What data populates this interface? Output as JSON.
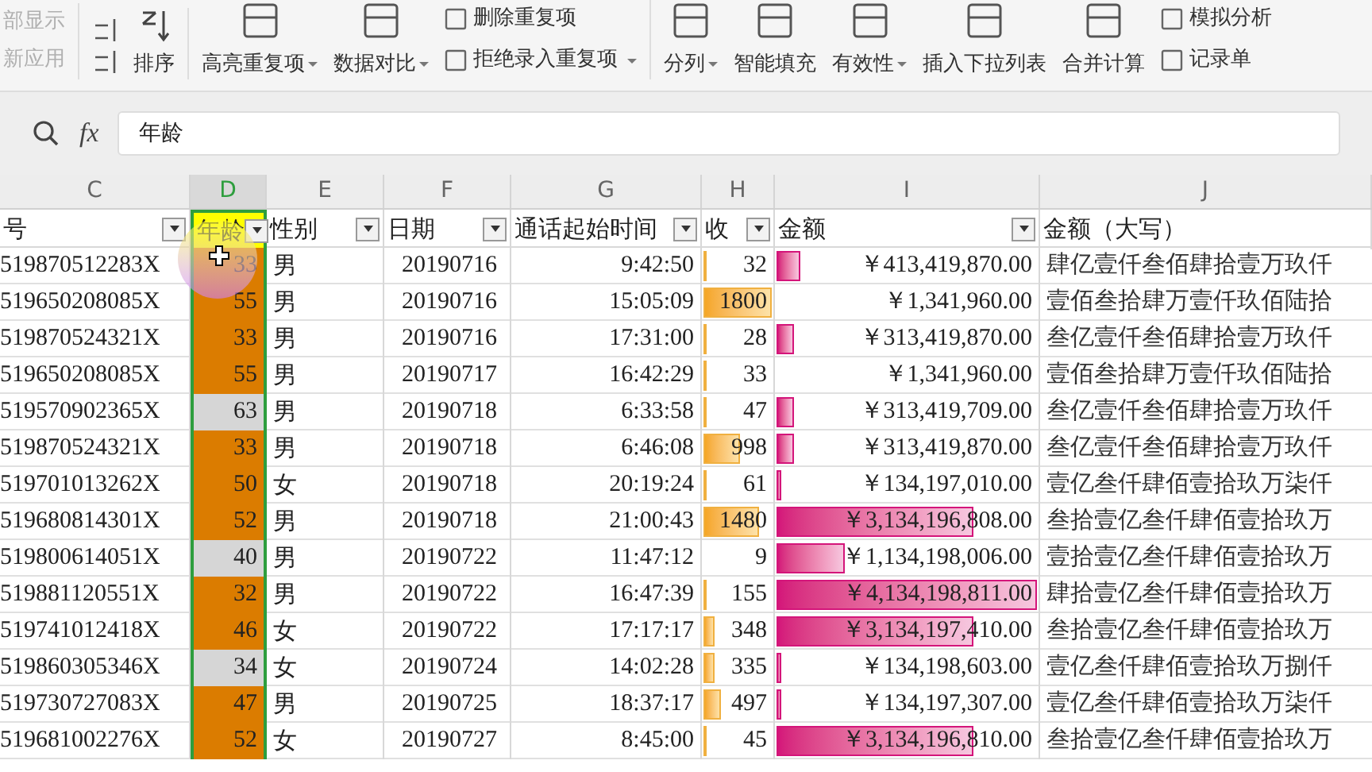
{
  "ribbon": {
    "items": [
      {
        "label": "部显示",
        "kind": "plain",
        "disabled": true
      },
      {
        "label": "新应用",
        "kind": "plain",
        "disabled": true
      },
      {
        "label": "排序",
        "kind": "sort",
        "disabled": false
      },
      {
        "label": "高亮重复项",
        "kind": "large",
        "dropdown": true,
        "disabled": false
      },
      {
        "label": "数据对比",
        "kind": "large",
        "dropdown": true,
        "disabled": false
      },
      {
        "label": "删除重复项",
        "kind": "small",
        "dropdown": false,
        "disabled": false
      },
      {
        "label": "拒绝录入重复项",
        "kind": "small",
        "dropdown": true,
        "disabled": false
      },
      {
        "label": "分列",
        "kind": "large",
        "dropdown": true,
        "disabled": false
      },
      {
        "label": "智能填充",
        "kind": "large",
        "dropdown": false,
        "disabled": false
      },
      {
        "label": "有效性",
        "kind": "large",
        "dropdown": true,
        "disabled": false
      },
      {
        "label": "插入下拉列表",
        "kind": "large",
        "dropdown": false,
        "disabled": false
      },
      {
        "label": "合并计算",
        "kind": "large",
        "dropdown": false,
        "disabled": false
      },
      {
        "label": "模拟分析",
        "kind": "small",
        "dropdown": false,
        "disabled": false
      },
      {
        "label": "记录单",
        "kind": "small",
        "dropdown": false,
        "disabled": false
      }
    ]
  },
  "formula_bar": {
    "fx": "fx",
    "value": "年龄"
  },
  "columns": [
    {
      "letter": "C",
      "selected": false
    },
    {
      "letter": "D",
      "selected": true
    },
    {
      "letter": "E",
      "selected": false
    },
    {
      "letter": "F",
      "selected": false
    },
    {
      "letter": "G",
      "selected": false
    },
    {
      "letter": "H",
      "selected": false
    },
    {
      "letter": "I",
      "selected": false
    },
    {
      "letter": "J",
      "selected": false
    }
  ],
  "headers": [
    {
      "label": "号",
      "filter": true
    },
    {
      "label": "年龄",
      "filter": true
    },
    {
      "label": "性别",
      "filter": true
    },
    {
      "label": "日期",
      "filter": true
    },
    {
      "label": "通话起始时间",
      "filter": true
    },
    {
      "label": "收",
      "filter": true
    },
    {
      "label": "金额",
      "filter": true
    },
    {
      "label": "金额（大写）",
      "filter": false
    }
  ],
  "rows": [
    {
      "id": "519870512283X",
      "age": "33",
      "duplicate": true,
      "gender": "男",
      "date": "20190716",
      "time": "9:42:50",
      "income": {
        "text": "32",
        "level": 0.02
      },
      "amount": {
        "text": "￥413,419,870.00",
        "level": 0.1
      },
      "amount_upper": "肆亿壹仟叁佰肆拾壹万玖仟"
    },
    {
      "id": "519650208085X",
      "age": "55",
      "duplicate": true,
      "gender": "男",
      "date": "20190716",
      "time": "15:05:09",
      "income": {
        "text": "1800",
        "level": 1
      },
      "amount": {
        "text": "￥1,341,960.00"
      },
      "amount_upper": "壹佰叁拾肆万壹仟玖佰陆拾"
    },
    {
      "id": "519870524321X",
      "age": "33",
      "duplicate": true,
      "gender": "男",
      "date": "20190716",
      "time": "17:31:00",
      "income": {
        "text": "28",
        "level": 0.02
      },
      "amount": {
        "text": "￥313,419,870.00",
        "level": 0.08
      },
      "amount_upper": "叁亿壹仟叁佰肆拾壹万玖仟"
    },
    {
      "id": "519650208085X",
      "age": "55",
      "duplicate": true,
      "gender": "男",
      "date": "20190717",
      "time": "16:42:29",
      "income": {
        "text": "33",
        "level": 0.02
      },
      "amount": {
        "text": "￥1,341,960.00"
      },
      "amount_upper": "壹佰叁拾肆万壹仟玖佰陆拾"
    },
    {
      "id": "519570902365X",
      "age": "63",
      "duplicate": false,
      "gender": "男",
      "date": "20190718",
      "time": "6:33:58",
      "income": {
        "text": "47",
        "level": 0.03
      },
      "amount": {
        "text": "￥313,419,709.00",
        "level": 0.08
      },
      "amount_upper": "叁亿壹仟叁佰肆拾壹万玖仟"
    },
    {
      "id": "519870524321X",
      "age": "33",
      "duplicate": true,
      "gender": "男",
      "date": "20190718",
      "time": "6:46:08",
      "income": {
        "text": "998",
        "level": 0.55
      },
      "amount": {
        "text": "￥313,419,870.00",
        "level": 0.08
      },
      "amount_upper": "叁亿壹仟叁佰肆拾壹万玖仟"
    },
    {
      "id": "519701013262X",
      "age": "50",
      "duplicate": true,
      "gender": "女",
      "date": "20190718",
      "time": "20:19:24",
      "income": {
        "text": "61",
        "level": 0.03
      },
      "amount": {
        "text": "￥134,197,010.00",
        "level": 0.03
      },
      "amount_upper": "壹亿叁仟肆佰壹拾玖万柒仟"
    },
    {
      "id": "519680814301X",
      "age": "52",
      "duplicate": true,
      "gender": "男",
      "date": "20190718",
      "time": "21:00:43",
      "income": {
        "text": "1480",
        "level": 0.82
      },
      "amount": {
        "text": "￥3,134,196,808.00",
        "level": 0.76
      },
      "amount_upper": "叁拾壹亿叁仟肆佰壹拾玖万"
    },
    {
      "id": "519800614051X",
      "age": "40",
      "duplicate": false,
      "gender": "男",
      "date": "20190722",
      "time": "11:47:12",
      "income": {
        "text": "9"
      },
      "amount": {
        "text": "￥1,134,198,006.00",
        "level": 0.27
      },
      "amount_upper": "壹拾壹亿叁仟肆佰壹拾玖万"
    },
    {
      "id": "519881120551X",
      "age": "32",
      "duplicate": true,
      "gender": "男",
      "date": "20190722",
      "time": "16:47:39",
      "income": {
        "text": "155",
        "level": 0.09
      },
      "amount": {
        "text": "￥4,134,198,811.00",
        "level": 1
      },
      "amount_upper": "肆拾壹亿叁仟肆佰壹拾玖万"
    },
    {
      "id": "519741012418X",
      "age": "46",
      "duplicate": true,
      "gender": "女",
      "date": "20190722",
      "time": "17:17:17",
      "income": {
        "text": "348",
        "level": 0.19
      },
      "amount": {
        "text": "￥3,134,197,410.00",
        "level": 0.76
      },
      "amount_upper": "叁拾壹亿叁仟肆佰壹拾玖万"
    },
    {
      "id": "519860305346X",
      "age": "34",
      "duplicate": false,
      "gender": "女",
      "date": "20190724",
      "time": "14:02:28",
      "income": {
        "text": "335",
        "level": 0.19
      },
      "amount": {
        "text": "￥134,198,603.00",
        "level": 0.03
      },
      "amount_upper": "壹亿叁仟肆佰壹拾玖万捌仟"
    },
    {
      "id": "519730727083X",
      "age": "47",
      "duplicate": true,
      "gender": "男",
      "date": "20190725",
      "time": "18:37:17",
      "income": {
        "text": "497",
        "level": 0.28
      },
      "amount": {
        "text": "￥134,197,307.00",
        "level": 0.03
      },
      "amount_upper": "壹亿叁仟肆佰壹拾玖万柒仟"
    },
    {
      "id": "519681002276X",
      "age": "52",
      "duplicate": true,
      "gender": "女",
      "date": "20190727",
      "time": "8:45:00",
      "income": {
        "text": "45",
        "level": 0.03
      },
      "amount": {
        "text": "￥3,134,196,810.00",
        "level": 0.76
      },
      "amount_upper": "叁拾壹亿叁仟肆佰壹拾玖万"
    }
  ]
}
